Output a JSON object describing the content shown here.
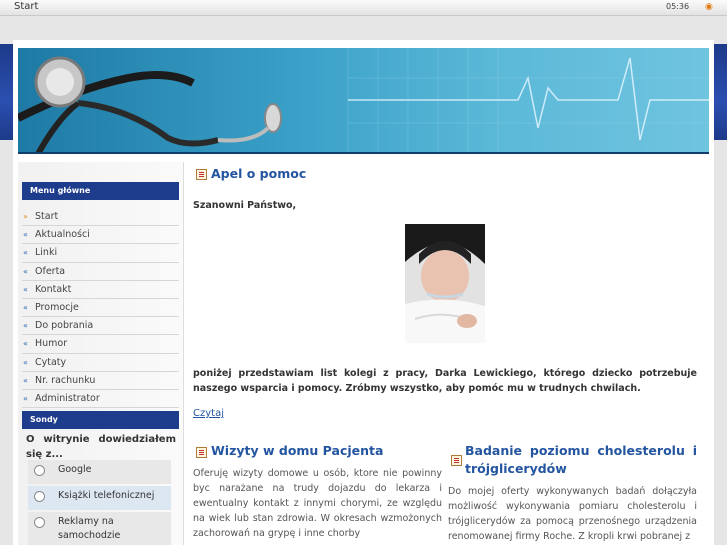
{
  "topbar": {
    "title": "Start",
    "time": "05:36"
  },
  "sidebar": {
    "menu_title": "Menu główne",
    "items": [
      "Start",
      "Aktualności",
      "Linki",
      "Oferta",
      "Kontakt",
      "Promocje",
      "Do pobrania",
      "Humor",
      "Cytaty",
      "Nr. rachunku",
      "Administrator"
    ],
    "poll_title": "Sondy",
    "poll_question": "O witrynie dowiedziałem się z...",
    "poll_options": [
      "Google",
      "Książki telefonicznej",
      "Reklamy na samochodzie"
    ]
  },
  "main": {
    "article_title": "Apel o pomoc",
    "greeting": "Szanowni Państwo,",
    "paragraph": "poniżej przedstawiam list kolegi z pracy, Darka Lewickiego, którego dziecko potrzebuje naszego wsparcia i pomocy. Zróbmy wszystko, aby pomóc mu w trudnych chwilach.",
    "read_more": "Czytaj",
    "col1_title": "Wizyty w domu Pacjenta",
    "col1_text": "Oferuję wizyty domowe u osób, ktore nie powinny byc narażane na trudy dojazdu do lekarza i ewentualny kontakt z innymi chorymi, ze względu na wiek lub stan zdrowia. W okresach wzmożonych zachorowań na grypę i inne chorby",
    "col2_title": "Badanie poziomu cholesterolu i trójglicerydów",
    "col2_text": "Do mojej oferty wykonywanych badań dołączyła możliwość wykonywania pomiaru cholesterolu i trójglicerydów za pomocą przenośnego urządzenia renomowanej firmy Roche. Z kropli krwi pobranej z"
  },
  "colors": {
    "menu_header": "#1e3c8c",
    "title_blue": "#2455a0",
    "banner": "#3aa0c8"
  },
  "icons": {
    "menu_bullet": "arrow-bullet-icon",
    "article": "document-icon",
    "feed": "rss-icon"
  }
}
